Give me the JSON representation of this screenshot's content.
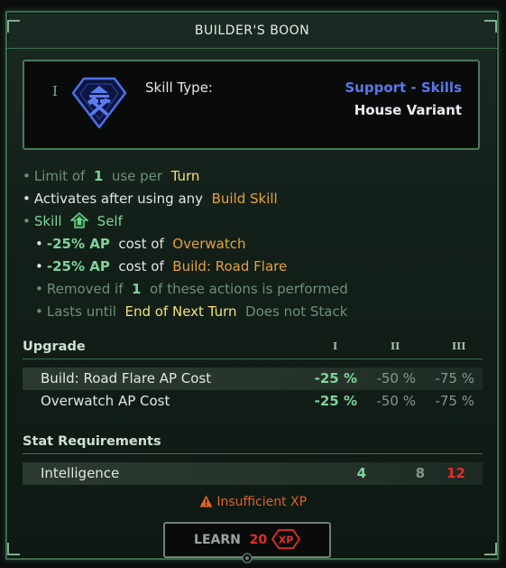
{
  "title": "BUILDER'S BOON",
  "skill": {
    "rank": "I",
    "type_label": "Skill Type:",
    "type_value": "Support - Skills",
    "variant": "House Variant",
    "icon": "hammer-pickaxe-icon"
  },
  "description": {
    "limit_prefix": "Limit of",
    "limit_count": "1",
    "limit_mid": "use per",
    "limit_period": "Turn",
    "activates_prefix": "Activates after using any",
    "activates_target": "Build Skill",
    "skill_word": "Skill",
    "skill_target": "Self",
    "mod1_value": "-25% AP",
    "mod1_mid": "cost of",
    "mod1_target": "Overwatch",
    "mod2_value": "-25% AP",
    "mod2_mid": "cost of",
    "mod2_target": "Build: Road Flare",
    "removed_prefix": "Removed if",
    "removed_count": "1",
    "removed_suffix": "of these actions is performed",
    "lasts_prefix": "Lasts until",
    "lasts_value": "End of Next Turn",
    "lasts_suffix": "Does not Stack"
  },
  "upgrade": {
    "header": "Upgrade",
    "ranks": [
      "I",
      "II",
      "III"
    ],
    "rows": [
      {
        "name": "Build: Road Flare AP Cost",
        "values": [
          "-25 %",
          "-50 %",
          "-75 %"
        ]
      },
      {
        "name": "Overwatch AP Cost",
        "values": [
          "-25 %",
          "-50 %",
          "-75 %"
        ]
      }
    ]
  },
  "requirements": {
    "header": "Stat Requirements",
    "rows": [
      {
        "name": "Intelligence",
        "values": [
          "4",
          "8",
          "12"
        ]
      }
    ]
  },
  "warning": "Insufficient XP",
  "learn": {
    "label": "LEARN",
    "cost": "20",
    "unit": "XP"
  },
  "colors": {
    "accent_green": "#7fd39a",
    "border_green": "#3d6b4c",
    "skill_blue": "#5a78e8",
    "orange": "#e2a341",
    "yellow": "#f2e07a",
    "red": "#e2302a"
  }
}
